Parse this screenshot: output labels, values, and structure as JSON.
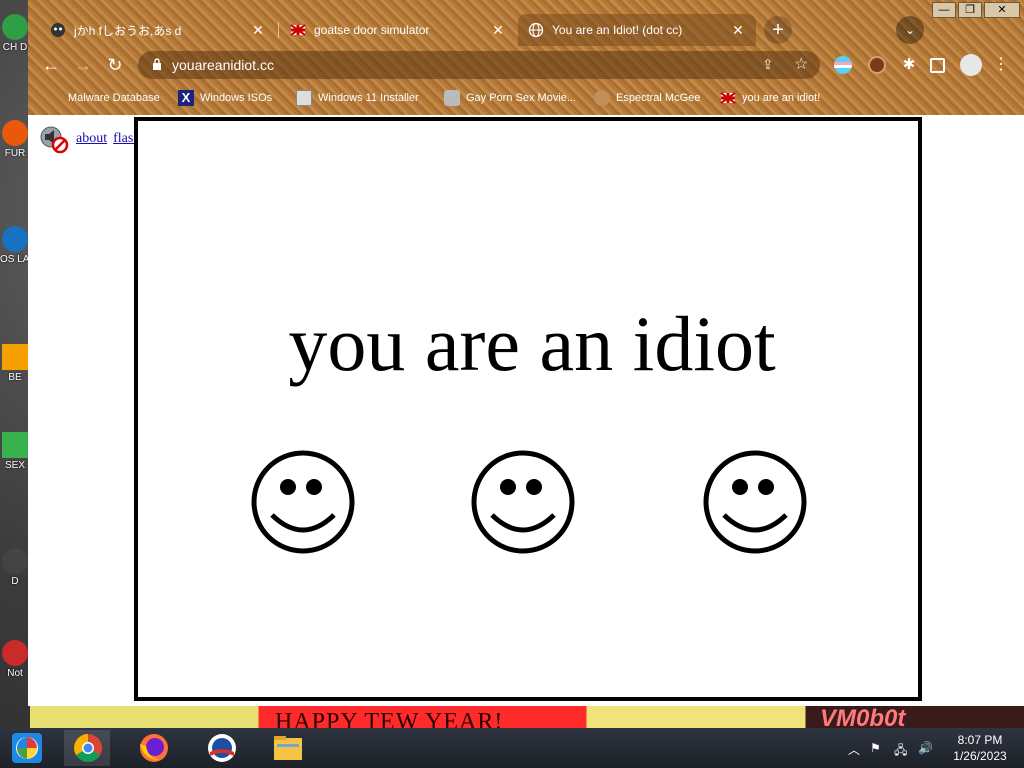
{
  "desktop": {
    "icons": [
      {
        "label": "CH D",
        "color": "#2f9e44"
      },
      {
        "label": "FUR",
        "color": "#e8590c"
      },
      {
        "label": "OS LAD",
        "color": "#1971c2"
      },
      {
        "label": "BE",
        "color": "#f59f00"
      },
      {
        "label": "SEX",
        "color": "#37b24d"
      },
      {
        "label": "D",
        "color": "#444444"
      },
      {
        "label": "Not",
        "color": "#c92a2a"
      }
    ],
    "wallpaper_text_1": "HAPPY TEW YEAR!",
    "wallpaper_text_2": "VM0b0t"
  },
  "browser": {
    "tabs": [
      {
        "title": "jかh fしおうお,あs d",
        "active": false
      },
      {
        "title": "goatse door simulator",
        "active": false
      },
      {
        "title": "You are an Idiot! (dot cc)",
        "active": true
      }
    ],
    "new_tab": "+",
    "window_controls": {
      "minimize": "—",
      "maximize": "❐",
      "close": "✕"
    },
    "address": "youareanidiot.cc",
    "bookmarks": [
      {
        "label": "Malware Database"
      },
      {
        "label": "Windows ISOs"
      },
      {
        "label": "Windows 11 Installer"
      },
      {
        "label": "Gay Porn Sex Movie..."
      },
      {
        "label": "Espectral McGee"
      },
      {
        "label": "you are an idiot!"
      }
    ]
  },
  "page": {
    "nav": {
      "about": "about",
      "flash": "flash"
    },
    "headline": "you are an idiot",
    "smiley_count": 3
  },
  "taskbar": {
    "clock_time": "8:07 PM",
    "clock_date": "1/26/2023"
  },
  "colors": {
    "chrome_theme": "#b57a3a",
    "link": "#1a0dab",
    "panel_border": "#000000"
  }
}
